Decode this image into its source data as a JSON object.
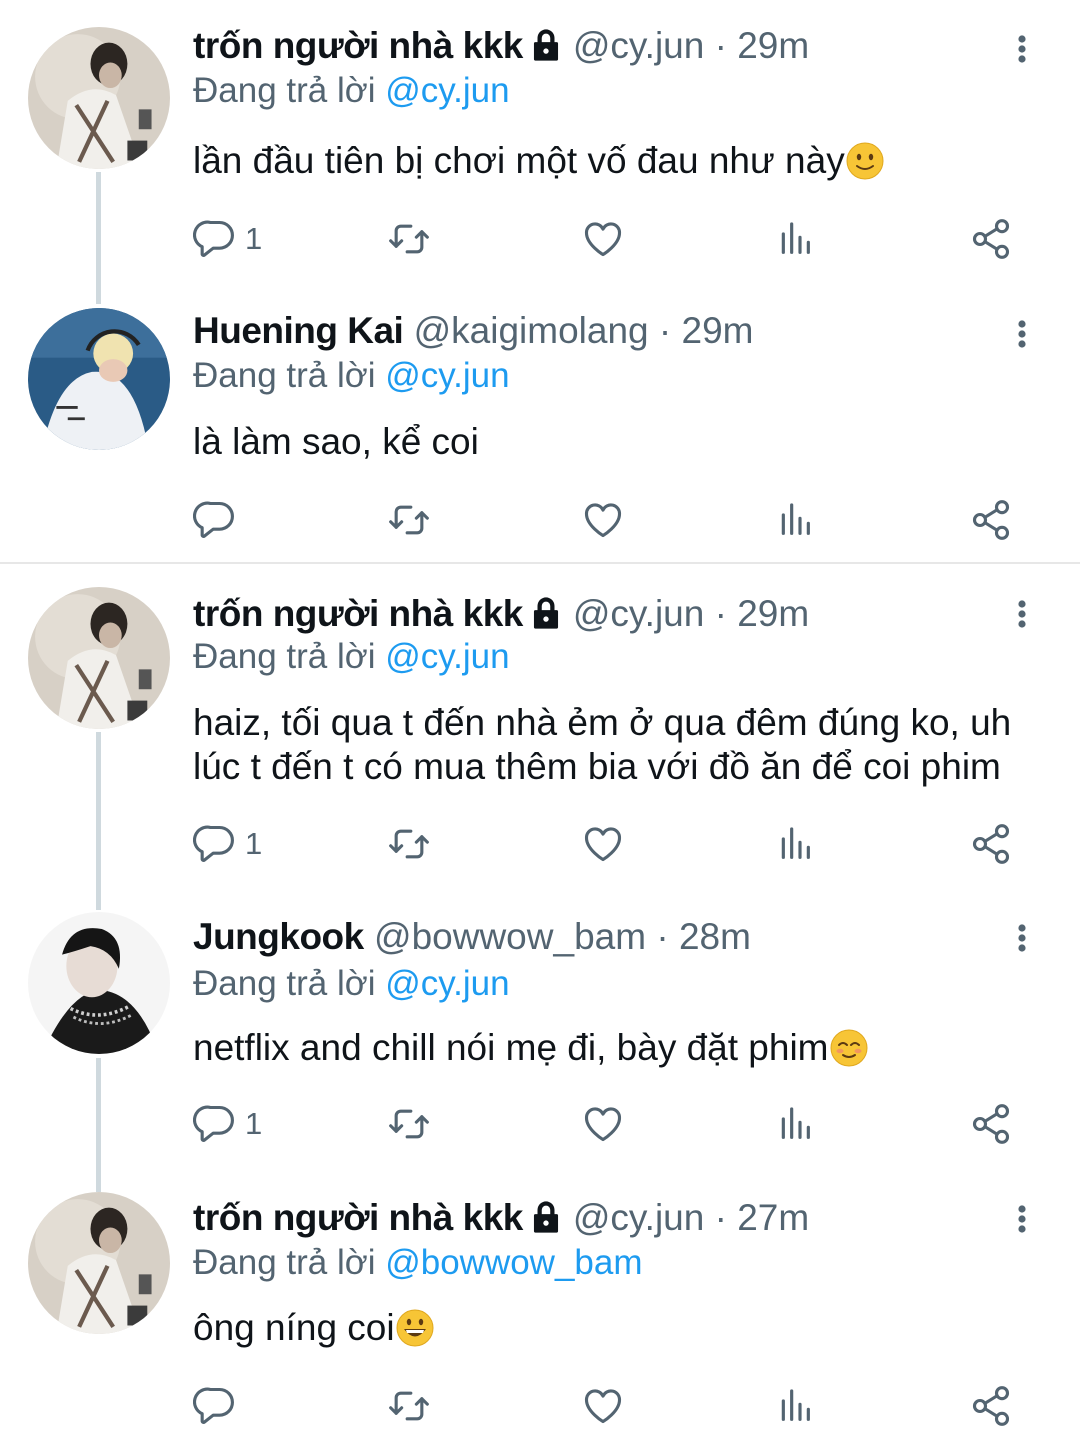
{
  "colors": {
    "link": "#1d9bf0",
    "muted": "#536471",
    "text": "#0f1419",
    "thread_line": "#cfd9de"
  },
  "reply_prefix": "Đang trả lời",
  "tweets": [
    {
      "name": "trốn người nhà kkk",
      "locked": true,
      "handle": "@cy.jun",
      "dot": "·",
      "time": "29m",
      "reply_to": "@cy.jun",
      "text": "lần đầu tiên bị chơi một vố đau như này",
      "emoji": "slightly-smiling-face",
      "reply_count": "1"
    },
    {
      "name": "Huening Kai",
      "locked": false,
      "handle": "@kaigimolang",
      "dot": "·",
      "time": "29m",
      "reply_to": "@cy.jun",
      "text": "là làm sao, kể coi",
      "reply_count": ""
    },
    {
      "name": "trốn người nhà kkk",
      "locked": true,
      "handle": "@cy.jun",
      "dot": "·",
      "time": "29m",
      "reply_to": "@cy.jun",
      "text": "haiz, tối qua t đến nhà ẻm ở qua đêm đúng ko, uh lúc t đến t có mua thêm bia với đồ ăn để coi phim",
      "reply_count": "1"
    },
    {
      "name": "Jungkook",
      "locked": false,
      "handle": "@bowwow_bam",
      "dot": "·",
      "time": "28m",
      "reply_to": "@cy.jun",
      "text": "netflix and chill nói mẹ đi, bày đặt phim",
      "emoji": "smiling-face",
      "reply_count": "1"
    },
    {
      "name": "trốn người nhà kkk",
      "locked": true,
      "handle": "@cy.jun",
      "dot": "·",
      "time": "27m",
      "reply_to": "@bowwow_bam",
      "text": "ông níng coi",
      "emoji": "grinning-face",
      "reply_count": ""
    }
  ]
}
